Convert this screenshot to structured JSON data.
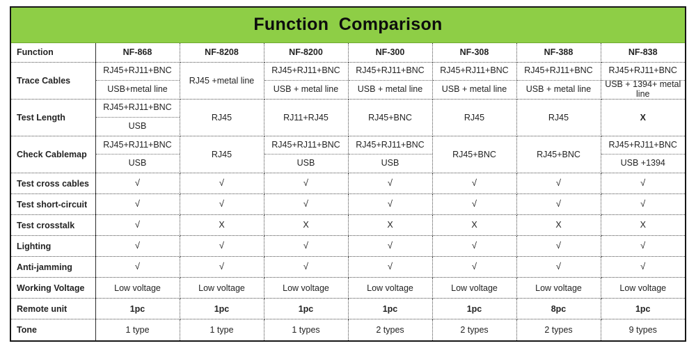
{
  "title": "Function  Comparison",
  "colors": {
    "header_green": "#8ECE46",
    "label_red": "#E8312A",
    "border_dark": "#161616",
    "text_dark": "#232323"
  },
  "columns": [
    {
      "label": "Function"
    },
    {
      "label": "NF-868"
    },
    {
      "label": "NF-8208"
    },
    {
      "label": "NF-8200"
    },
    {
      "label": "NF-300"
    },
    {
      "label": "NF-308"
    },
    {
      "label": "NF-388"
    },
    {
      "label": "NF-838"
    }
  ],
  "rows": [
    {
      "label": "Trace Cables",
      "cells": [
        {
          "split": true,
          "top": "RJ45+RJ11+BNC",
          "bottom": "USB+metal line"
        },
        {
          "split": false,
          "value": "RJ45 +metal line"
        },
        {
          "split": true,
          "top": "RJ45+RJ11+BNC",
          "bottom": "USB + metal line"
        },
        {
          "split": true,
          "top": "RJ45+RJ11+BNC",
          "bottom": "USB + metal line"
        },
        {
          "split": true,
          "top": "RJ45+RJ11+BNC",
          "bottom": "USB + metal line"
        },
        {
          "split": true,
          "top": "RJ45+RJ11+BNC",
          "bottom": "USB + metal line"
        },
        {
          "split": true,
          "top": "RJ45+RJ11+BNC",
          "bottom": "USB + 1394+ metal line"
        }
      ]
    },
    {
      "label": "Test Length",
      "cells": [
        {
          "split": true,
          "top": "RJ45+RJ11+BNC",
          "bottom": "USB"
        },
        {
          "split": false,
          "value": "RJ45"
        },
        {
          "split": false,
          "value": "RJ11+RJ45"
        },
        {
          "split": false,
          "value": "RJ45+BNC"
        },
        {
          "split": false,
          "value": "RJ45"
        },
        {
          "split": false,
          "value": "RJ45"
        },
        {
          "split": false,
          "value": "X",
          "bold": true
        }
      ]
    },
    {
      "label": "Check Cablemap",
      "cells": [
        {
          "split": true,
          "top": "RJ45+RJ11+BNC",
          "bottom": "USB"
        },
        {
          "split": false,
          "value": "RJ45"
        },
        {
          "split": true,
          "top": "RJ45+RJ11+BNC",
          "bottom": "USB"
        },
        {
          "split": true,
          "top": "RJ45+RJ11+BNC",
          "bottom": "USB"
        },
        {
          "split": false,
          "value": "RJ45+BNC"
        },
        {
          "split": false,
          "value": "RJ45+BNC"
        },
        {
          "split": true,
          "top": "RJ45+RJ11+BNC",
          "bottom": "USB +1394"
        }
      ]
    },
    {
      "label": "Test cross cables",
      "cells": [
        {
          "split": false,
          "value": "√",
          "mark": true
        },
        {
          "split": false,
          "value": "√",
          "mark": true
        },
        {
          "split": false,
          "value": "√",
          "mark": true
        },
        {
          "split": false,
          "value": "√",
          "mark": true
        },
        {
          "split": false,
          "value": "√",
          "mark": true
        },
        {
          "split": false,
          "value": "√",
          "mark": true
        },
        {
          "split": false,
          "value": "√",
          "mark": true
        }
      ]
    },
    {
      "label": "Test short-circuit",
      "cells": [
        {
          "split": false,
          "value": "√",
          "mark": true
        },
        {
          "split": false,
          "value": "√",
          "mark": true
        },
        {
          "split": false,
          "value": "√",
          "mark": true
        },
        {
          "split": false,
          "value": "√",
          "mark": true
        },
        {
          "split": false,
          "value": "√",
          "mark": true
        },
        {
          "split": false,
          "value": "√",
          "mark": true
        },
        {
          "split": false,
          "value": "√",
          "mark": true
        }
      ]
    },
    {
      "label": "Test crosstalk",
      "cells": [
        {
          "split": false,
          "value": "√",
          "mark": true
        },
        {
          "split": false,
          "value": "X"
        },
        {
          "split": false,
          "value": "X"
        },
        {
          "split": false,
          "value": "X"
        },
        {
          "split": false,
          "value": "X"
        },
        {
          "split": false,
          "value": "X"
        },
        {
          "split": false,
          "value": "X"
        }
      ]
    },
    {
      "label": "Lighting",
      "cells": [
        {
          "split": false,
          "value": "√",
          "mark": true
        },
        {
          "split": false,
          "value": "√",
          "mark": true
        },
        {
          "split": false,
          "value": "√",
          "mark": true
        },
        {
          "split": false,
          "value": "√",
          "mark": true
        },
        {
          "split": false,
          "value": "√",
          "mark": true
        },
        {
          "split": false,
          "value": "√",
          "mark": true
        },
        {
          "split": false,
          "value": "√",
          "mark": true
        }
      ]
    },
    {
      "label": "Anti-jamming",
      "cells": [
        {
          "split": false,
          "value": "√",
          "mark": true
        },
        {
          "split": false,
          "value": "√",
          "mark": true
        },
        {
          "split": false,
          "value": "√",
          "mark": true
        },
        {
          "split": false,
          "value": "√",
          "mark": true
        },
        {
          "split": false,
          "value": "√",
          "mark": true
        },
        {
          "split": false,
          "value": "√",
          "mark": true
        },
        {
          "split": false,
          "value": "√",
          "mark": true
        }
      ]
    },
    {
      "label": "Working Voltage",
      "cells": [
        {
          "split": false,
          "value": "Low voltage"
        },
        {
          "split": false,
          "value": "Low voltage"
        },
        {
          "split": false,
          "value": "Low voltage"
        },
        {
          "split": false,
          "value": "Low voltage"
        },
        {
          "split": false,
          "value": "Low voltage"
        },
        {
          "split": false,
          "value": "Low voltage"
        },
        {
          "split": false,
          "value": "Low voltage"
        }
      ]
    },
    {
      "label": "Remote unit",
      "cells": [
        {
          "split": false,
          "value": "1pc",
          "bold": true
        },
        {
          "split": false,
          "value": "1pc",
          "bold": true
        },
        {
          "split": false,
          "value": "1pc",
          "bold": true
        },
        {
          "split": false,
          "value": "1pc",
          "bold": true
        },
        {
          "split": false,
          "value": "1pc",
          "bold": true
        },
        {
          "split": false,
          "value": "8pc",
          "bold": true
        },
        {
          "split": false,
          "value": "1pc",
          "bold": true
        }
      ]
    },
    {
      "label": "Tone",
      "cells": [
        {
          "split": false,
          "value": "1 type"
        },
        {
          "split": false,
          "value": "1 type"
        },
        {
          "split": false,
          "value": "1 types"
        },
        {
          "split": false,
          "value": "2 types"
        },
        {
          "split": false,
          "value": "2 types"
        },
        {
          "split": false,
          "value": "2 types"
        },
        {
          "split": false,
          "value": "9 types"
        }
      ]
    }
  ]
}
